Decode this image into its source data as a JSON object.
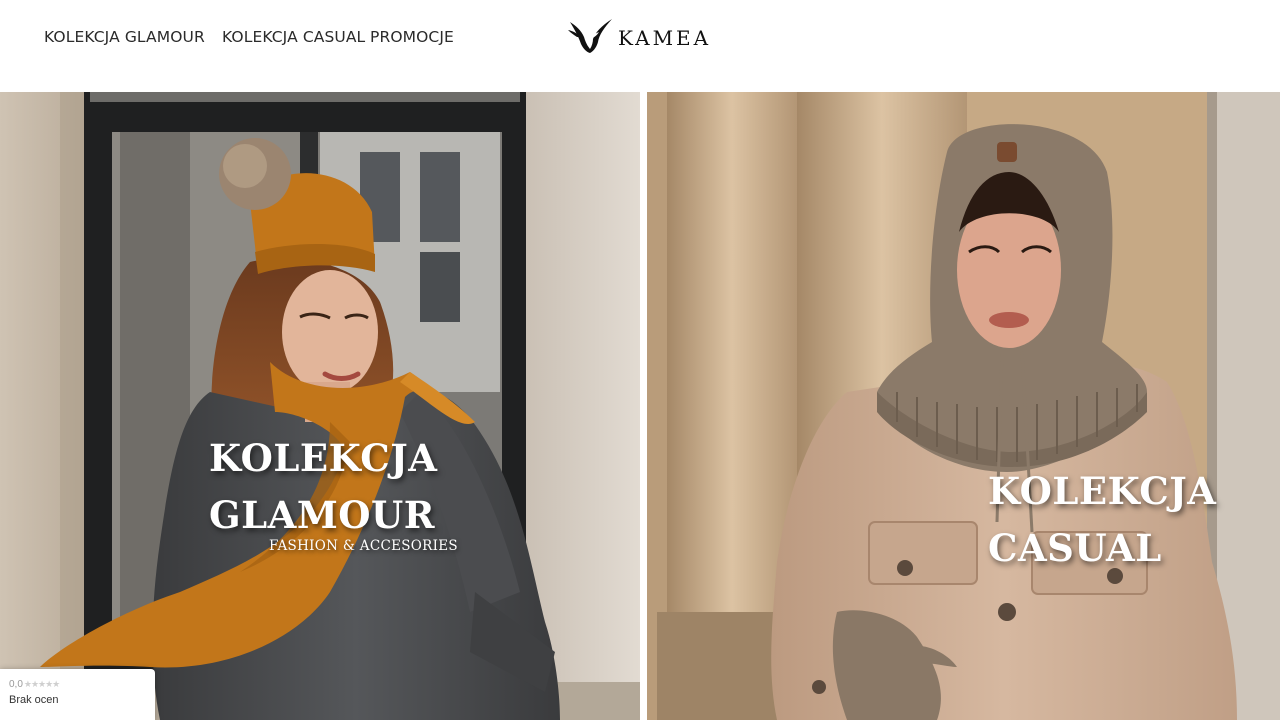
{
  "nav": {
    "items": [
      {
        "label": "KOLEKCJA GLAMOUR"
      },
      {
        "label": "KOLEKCJA CASUAL"
      },
      {
        "label": "PROMOCJE"
      }
    ]
  },
  "brand": {
    "name": "KAMEA",
    "icon": "swallow-bird-icon"
  },
  "hero": {
    "glamour": {
      "title_line1": "KOLEKCJA",
      "title_line2": "GLAMOUR",
      "subtitle": "FASHION & ACCESORIES"
    },
    "casual": {
      "title_line1": "KOLEKCJA",
      "title_line2": "CASUAL"
    }
  },
  "rating": {
    "score": "0,0",
    "stars": "★★★★★",
    "label": "Brak ocen"
  },
  "colors": {
    "accent_mustard": "#c2761a",
    "coat_beige": "#c9a98e",
    "knit_taupe": "#8b7a69"
  }
}
